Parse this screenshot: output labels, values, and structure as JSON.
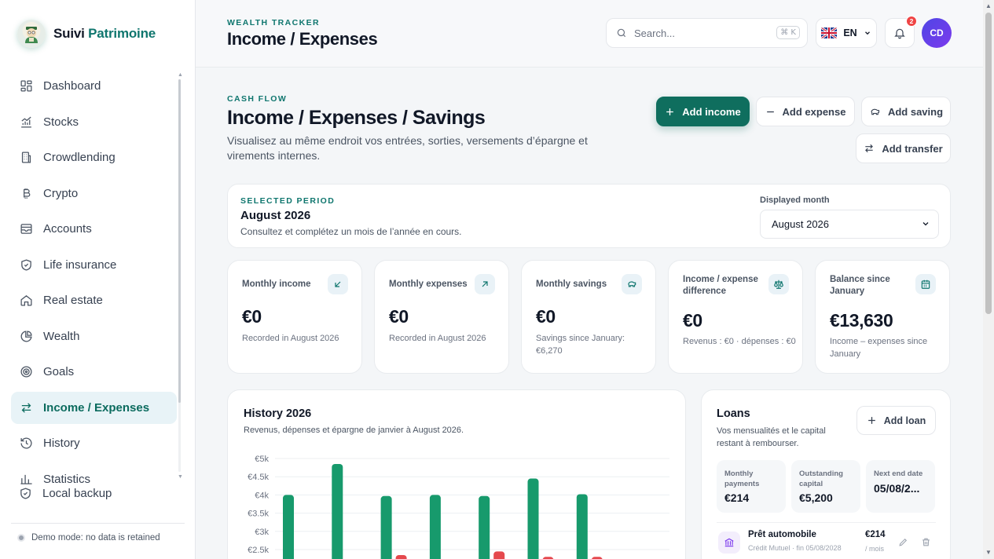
{
  "brand": {
    "name_part1": "Suivi",
    "name_part2": "Patrimoine"
  },
  "sidebar": {
    "items": [
      {
        "label": "Dashboard",
        "icon": "dashboard-icon"
      },
      {
        "label": "Stocks",
        "icon": "stocks-icon"
      },
      {
        "label": "Crowdlending",
        "icon": "building-icon"
      },
      {
        "label": "Crypto",
        "icon": "bitcoin-icon"
      },
      {
        "label": "Accounts",
        "icon": "wallet-icon"
      },
      {
        "label": "Life insurance",
        "icon": "shield-icon"
      },
      {
        "label": "Real estate",
        "icon": "home-icon"
      },
      {
        "label": "Wealth",
        "icon": "pie-chart-icon"
      },
      {
        "label": "Goals",
        "icon": "target-icon"
      },
      {
        "label": "Income / Expenses",
        "icon": "transfer-icon",
        "active": true
      },
      {
        "label": "History",
        "icon": "history-icon"
      },
      {
        "label": "Statistics",
        "icon": "bar-chart-icon"
      }
    ],
    "backup_label": "Local backup",
    "demo_text": "Demo mode: no data is retained"
  },
  "header": {
    "eyebrow": "WEALTH TRACKER",
    "title": "Income / Expenses",
    "search_placeholder": "Search...",
    "search_shortcut": "⌘ K",
    "language": "EN",
    "notification_count": "2",
    "avatar_initials": "CD"
  },
  "cashflow": {
    "eyebrow": "CASH FLOW",
    "title": "Income / Expenses / Savings",
    "description": "Visualisez au même endroit vos entrées, sorties, versements d’épargne et virements internes.",
    "buttons": {
      "add_income": "Add income",
      "add_expense": "Add expense",
      "add_saving": "Add saving",
      "add_transfer": "Add transfer"
    }
  },
  "period": {
    "eyebrow": "SELECTED PERIOD",
    "value": "August 2026",
    "description": "Consultez et complétez un mois de l’année en cours.",
    "month_label": "Displayed month",
    "month_selected": "August 2026"
  },
  "kpis": [
    {
      "label": "Monthly income",
      "value": "€0",
      "sub": "Recorded in August 2026",
      "icon": "arrow-down-left-icon"
    },
    {
      "label": "Monthly expenses",
      "value": "€0",
      "sub": "Recorded in August 2026",
      "icon": "arrow-up-right-icon"
    },
    {
      "label": "Monthly savings",
      "value": "€0",
      "sub": "Savings since January: €6,270",
      "icon": "piggy-bank-icon"
    },
    {
      "label": "Income / expense difference",
      "value": "€0",
      "sub": "Revenus : €0 · dépenses : €0",
      "icon": "scale-icon"
    },
    {
      "label": "Balance since January",
      "value": "€13,630",
      "sub": "Income – expenses since January",
      "icon": "calendar-icon"
    }
  ],
  "history": {
    "title": "History 2026",
    "subtitle": "Revenus, dépenses et épargne de janvier à August 2026."
  },
  "chart_data": {
    "type": "bar",
    "ylim": [
      2000,
      5000
    ],
    "y_ticks": [
      "€5k",
      "€4.5k",
      "€4k",
      "€3.5k",
      "€3k",
      "€2.5k"
    ],
    "y_tick_values": [
      5000,
      4500,
      4000,
      3500,
      3000,
      2500
    ],
    "series": [
      {
        "color": "#179a6c",
        "values": [
          4000,
          4850,
          3970,
          4000,
          3970,
          4450,
          4020
        ]
      },
      {
        "color": "#e5484d",
        "values": [
          null,
          null,
          2350,
          null,
          2450,
          2300,
          2300
        ]
      }
    ]
  },
  "loans": {
    "title": "Loans",
    "subtitle": "Vos mensualités et le capital restant à rembourser.",
    "add_label": "Add loan",
    "stats": [
      {
        "label": "Monthly payments",
        "value": "€214"
      },
      {
        "label": "Outstanding capital",
        "value": "€5,200"
      },
      {
        "label": "Next end date",
        "value": "05/08/2..."
      }
    ],
    "items": [
      {
        "name": "Prêt automobile",
        "meta": "Crédit Mutuel · fin 05/08/2028",
        "amount": "€214",
        "period": "/ mois"
      }
    ]
  },
  "colors": {
    "accent": "#0f6e5e",
    "active_bg": "#e8f3f7",
    "income_bar": "#179a6c",
    "expense_bar": "#e5484d"
  }
}
